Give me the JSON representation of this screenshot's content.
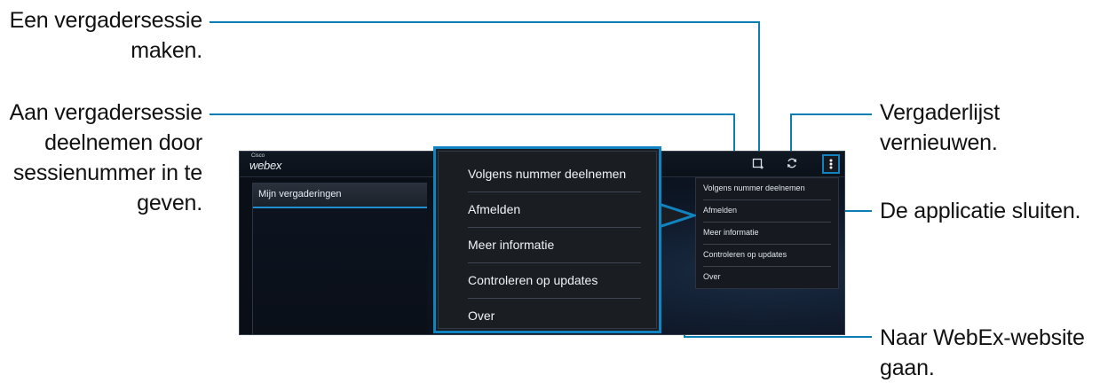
{
  "callouts": {
    "create_session": [
      "Een vergadersessie",
      "maken."
    ],
    "join_by_number": [
      "Aan vergadersessie",
      "deelnemen door",
      "sessienummer in te",
      "geven."
    ],
    "refresh_list": [
      "Vergaderlijst",
      "vernieuwen."
    ],
    "close_app": "De applicatie sluiten.",
    "website": [
      "Naar WebEx-website",
      "gaan."
    ]
  },
  "app": {
    "logo_small": "Cisco",
    "logo": "webex",
    "sidebar_item": "Mijn vergaderingen",
    "toolbar_icons": [
      "new-meeting-icon",
      "refresh-icon",
      "overflow-menu-icon"
    ]
  },
  "menu": {
    "items": [
      "Volgens nummer deelnemen",
      "Afmelden",
      "Meer informatie",
      "Controleren op updates",
      "Over"
    ]
  },
  "colors": {
    "accent": "#1083c0",
    "app_background": "#0a0f17",
    "menu_background": "#161a20"
  }
}
